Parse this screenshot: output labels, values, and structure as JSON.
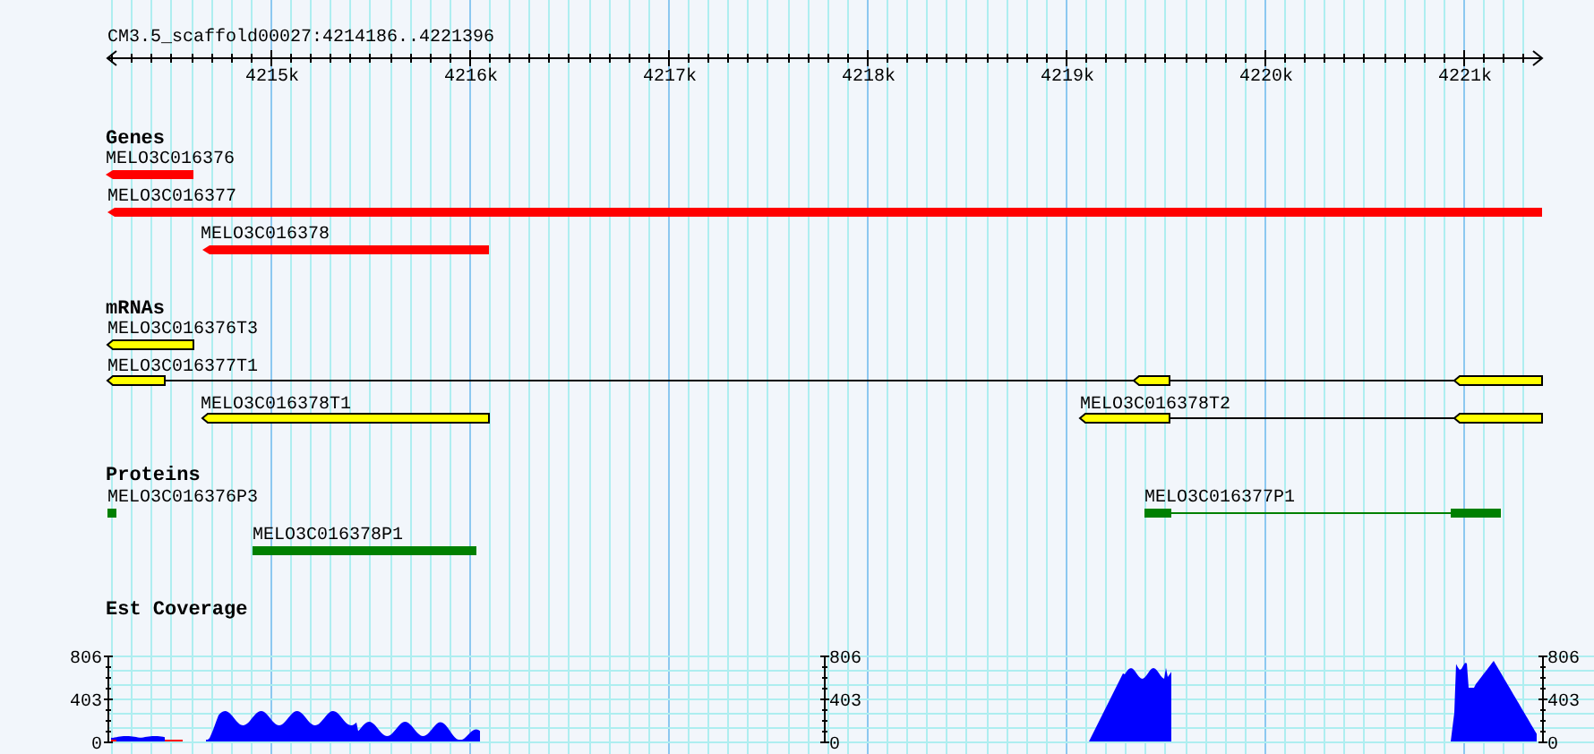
{
  "ruler": {
    "title": "CM3.5_scaffold00027:4214186..4221396",
    "ticks": [
      "4215k",
      "4216k",
      "4217k",
      "4218k",
      "4219k",
      "4220k",
      "4221k"
    ]
  },
  "tracks": [
    {
      "kind": "genes",
      "title": "Genes",
      "features": [
        {
          "label": "MELO3C016376"
        },
        {
          "label": "MELO3C016377"
        },
        {
          "label": "MELO3C016378"
        }
      ]
    },
    {
      "kind": "mrnas",
      "title": "mRNAs",
      "features": [
        {
          "label": "MELO3C016376T3"
        },
        {
          "label": "MELO3C016377T1"
        },
        {
          "label": "MELO3C016378T1"
        },
        {
          "label": "MELO3C016378T2"
        }
      ]
    },
    {
      "kind": "proteins",
      "title": "Proteins",
      "features": [
        {
          "label": "MELO3C016376P3"
        },
        {
          "label": "MELO3C016378P1"
        },
        {
          "label": "MELO3C016377P1"
        }
      ]
    }
  ],
  "coverage": {
    "title": "Est Coverage",
    "axes": [
      {
        "labels": [
          "806",
          "403",
          "0"
        ]
      },
      {
        "labels": [
          "806",
          "403",
          "0"
        ]
      },
      {
        "labels": [
          "806",
          "403",
          "0"
        ]
      }
    ]
  }
}
